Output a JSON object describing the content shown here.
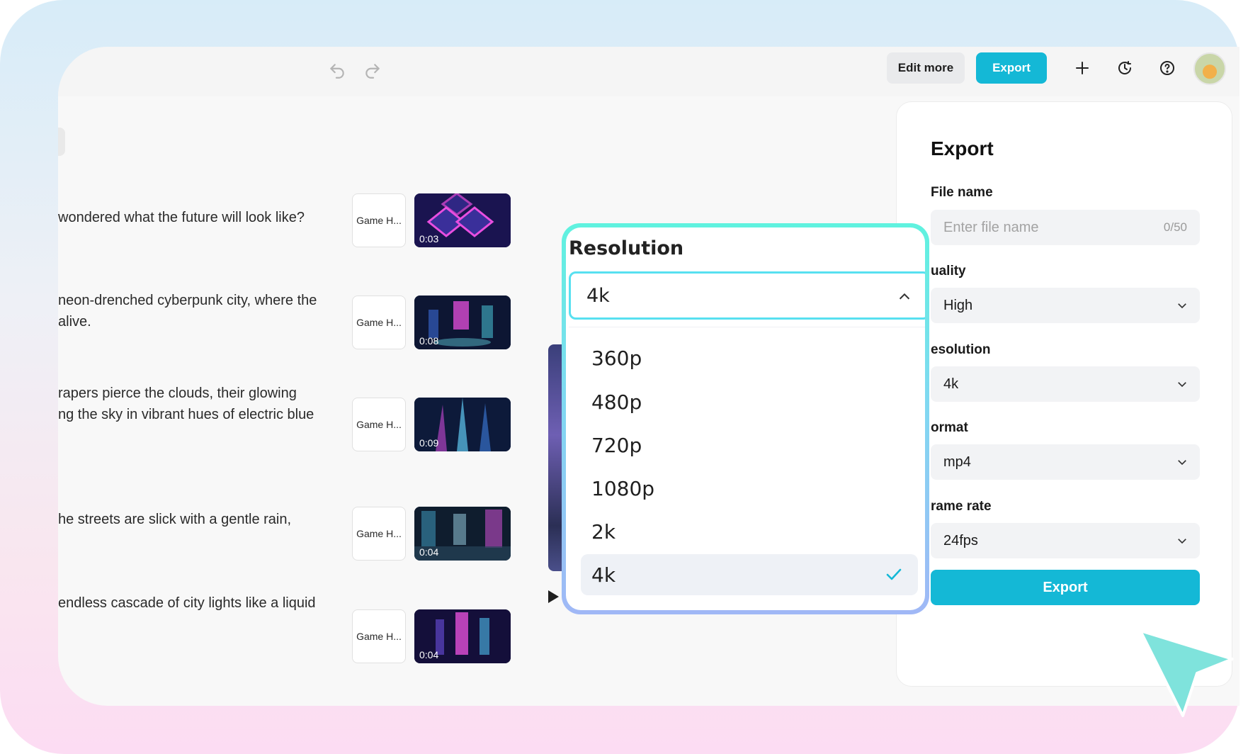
{
  "toolbar": {
    "undo_icon": "undo-icon",
    "redo_icon": "redo-icon",
    "edit_more_label": "Edit more",
    "export_label": "Export",
    "add_icon": "plus-icon",
    "history_icon": "clock-icon",
    "help_icon": "help-icon"
  },
  "scenes": [
    {
      "text": "wondered what the future will look like?",
      "tag": "Game H...",
      "duration": "0:03"
    },
    {
      "text": "neon-drenched cyberpunk city, where the\nalive.",
      "tag": "Game H...",
      "duration": "0:08"
    },
    {
      "text": "rapers pierce the clouds, their glowing\nng the sky in vibrant hues of electric blue",
      "tag": "Game H...",
      "duration": "0:09"
    },
    {
      "text": "he streets are slick with a gentle rain,",
      "tag": "Game H...",
      "duration": "0:04"
    },
    {
      "text": "endless cascade of city lights like a liquid",
      "tag": "Game H...",
      "duration": "0:04"
    }
  ],
  "export_panel": {
    "title": "Export",
    "file_name_label": "File name",
    "file_name_placeholder": "Enter file name",
    "file_name_counter": "0/50",
    "quality_label": "uality",
    "quality_value": "High",
    "resolution_label": "esolution",
    "resolution_value": "4k",
    "format_label": "ormat",
    "format_value": "mp4",
    "frame_rate_label": "rame rate",
    "frame_rate_value": "24fps",
    "export_button": "Export"
  },
  "resolution_popup": {
    "title": "Resolution",
    "selected": "4k",
    "options": [
      "360p",
      "480p",
      "720p",
      "1080p",
      "2k",
      "4k"
    ]
  },
  "colors": {
    "accent": "#14b8d6",
    "popup_gradient_top": "#5ff2df",
    "popup_gradient_bottom": "#a0b8f6",
    "check": "#14b8d6"
  }
}
